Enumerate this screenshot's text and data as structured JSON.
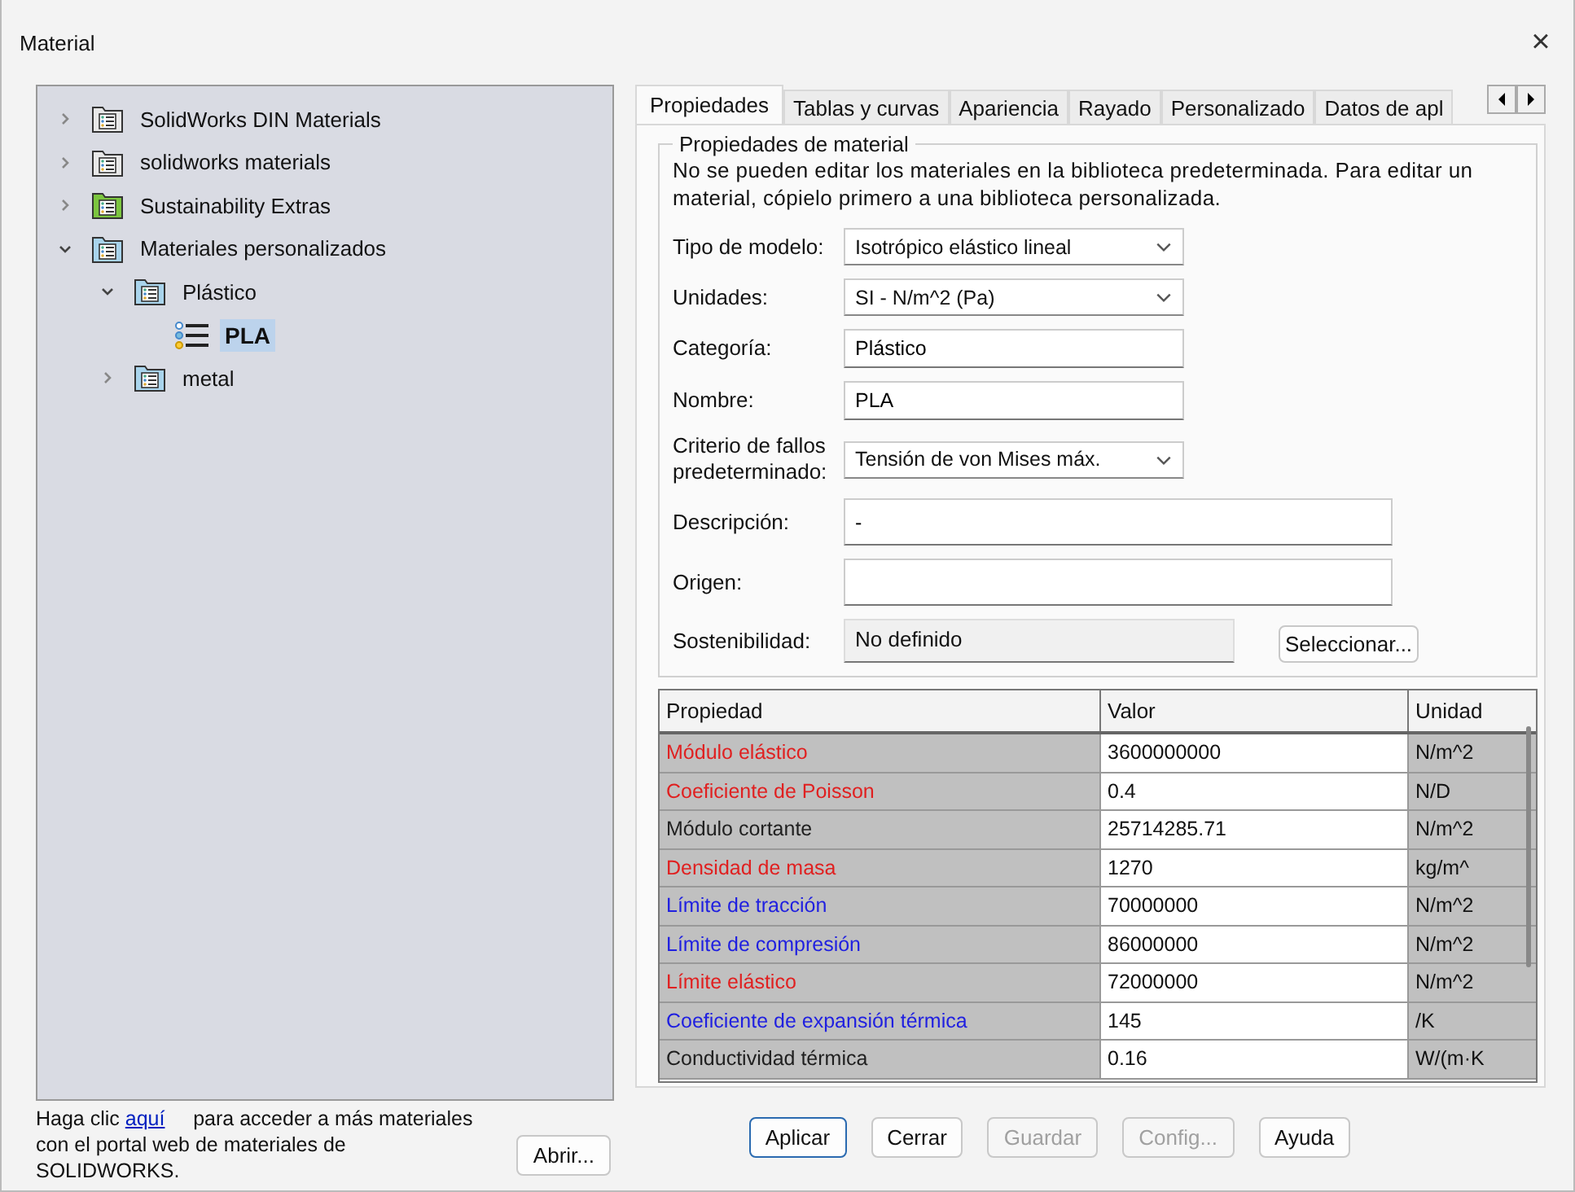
{
  "window": {
    "title": "Material",
    "close": "×"
  },
  "tree": [
    {
      "label": "SolidWorks DIN Materials",
      "kind": "folder",
      "color": "#e8e8e8",
      "expanded": false,
      "selected": false
    },
    {
      "label": "solidworks materials",
      "kind": "folder",
      "color": "#e8e8e8",
      "expanded": false,
      "selected": false
    },
    {
      "label": "Sustainability Extras",
      "kind": "folder",
      "color": "#7cc63f",
      "expanded": false,
      "selected": false
    },
    {
      "label": "Materiales personalizados",
      "kind": "folder",
      "color": "#a9d4ec",
      "expanded": true,
      "selected": false,
      "children": [
        {
          "label": "Plástico",
          "kind": "folder",
          "color": "#a9d4ec",
          "expanded": true,
          "selected": false,
          "children": [
            {
              "label": "PLA",
              "kind": "material",
              "selected": true
            }
          ]
        },
        {
          "label": "metal",
          "kind": "folder",
          "color": "#a9d4ec",
          "expanded": false,
          "selected": false
        }
      ]
    }
  ],
  "portal_note": {
    "before": "Haga clic",
    "link": "aquí",
    "after": "para acceder a más materiales con el portal web de materiales de SOLIDWORKS."
  },
  "open_button": "Abrir...",
  "tabs": [
    {
      "label": "Propiedades",
      "selected": true
    },
    {
      "label": "Tablas y curvas",
      "selected": false
    },
    {
      "label": "Apariencia",
      "selected": false
    },
    {
      "label": "Rayado",
      "selected": false
    },
    {
      "label": "Personalizado",
      "selected": false
    },
    {
      "label": "Datos de apl",
      "selected": false
    }
  ],
  "material_properties": {
    "title": "Propiedades de material",
    "note": "No se pueden editar los materiales en la biblioteca predeterminada. Para editar un material, cópielo primero a una biblioteca personalizada.",
    "fields": [
      {
        "label": "Tipo de modelo:",
        "value": "Isotrópico elástico lineal",
        "kind": "dropdown"
      },
      {
        "label": "Unidades:",
        "value": "SI - N/m^2 (Pa)",
        "kind": "dropdown"
      },
      {
        "label": "Categoría:",
        "value": "Plástico",
        "kind": "text"
      },
      {
        "label": "Nombre:",
        "value": "PLA",
        "kind": "text"
      },
      {
        "label": "Criterio de fallos predeterminado:",
        "value": "Tensión de von Mises máx.",
        "kind": "dropdown"
      },
      {
        "label": "Descripción:",
        "value": "-",
        "kind": "wide"
      },
      {
        "label": "Origen:",
        "kind": "wide"
      },
      {
        "label": "Sostenibilidad:",
        "value": "No definido",
        "kind": "readonly",
        "button": "Seleccionar..."
      }
    ]
  },
  "table": {
    "columns": [
      "Propiedad",
      "Valor",
      "Unidad"
    ],
    "rows": [
      {
        "property": "Módulo elástico",
        "value": "3600000000",
        "unit": "N/m^2",
        "color": "#e02020"
      },
      {
        "property": "Coeficiente de Poisson",
        "value": "0.4",
        "unit": "N/D",
        "color": "#e02020"
      },
      {
        "property": "Módulo cortante",
        "value": "25714285.71",
        "unit": "N/m^2",
        "color": "#202020"
      },
      {
        "property": "Densidad de masa",
        "value": "1270",
        "unit": "kg/m^",
        "color": "#e02020"
      },
      {
        "property": "Límite de tracción",
        "value": "70000000",
        "unit": "N/m^2",
        "color": "#2020e0"
      },
      {
        "property": "Límite de compresión",
        "value": "86000000",
        "unit": "N/m^2",
        "color": "#2020e0"
      },
      {
        "property": "Límite elástico",
        "value": "72000000",
        "unit": "N/m^2",
        "color": "#e02020"
      },
      {
        "property": "Coeficiente de expansión térmica",
        "value": "145",
        "unit": "/K",
        "color": "#2020e0"
      },
      {
        "property": "Conductividad térmica",
        "value": "0.16",
        "unit": "W/(m·K",
        "color": "#202020"
      }
    ]
  },
  "buttons": [
    {
      "label": "Aplicar",
      "disabled": false,
      "default": true
    },
    {
      "label": "Cerrar",
      "disabled": false,
      "default": false
    },
    {
      "label": "Guardar",
      "disabled": true,
      "default": false
    },
    {
      "label": "Config...",
      "disabled": true,
      "default": false
    },
    {
      "label": "Ayuda",
      "disabled": false,
      "default": false
    }
  ]
}
